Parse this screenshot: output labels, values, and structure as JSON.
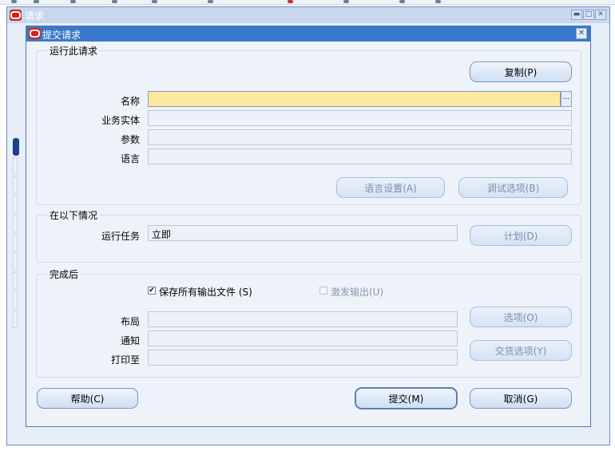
{
  "background_window": {
    "title": "请求"
  },
  "dialog": {
    "title": "提交请求",
    "run_group": {
      "legend": "运行此请求",
      "copy_button": "复制(P)",
      "name_label": "名称",
      "name_value": "",
      "lov_button": "...",
      "ou_label": "业务实体",
      "ou_value": "",
      "params_label": "参数",
      "params_value": "",
      "language_label": "语言",
      "language_value": "",
      "language_settings_button": "语言设置(A)",
      "debug_options_button": "调试选项(B)"
    },
    "when_group": {
      "legend": "在以下情况",
      "run_job_label": "运行任务",
      "run_job_value": "立即",
      "schedule_button": "计划(D)"
    },
    "completion_group": {
      "legend": "完成后",
      "save_output_label": "保存所有输出文件 (S)",
      "save_output_checked": true,
      "burst_output_label": "激发输出(U)",
      "burst_output_checked": false,
      "layout_label": "布局",
      "layout_value": "",
      "notify_label": "通知",
      "notify_value": "",
      "print_to_label": "打印至",
      "print_to_value": "",
      "options_button": "选项(O)",
      "delivery_options_button": "交货选项(Y)"
    },
    "help_button": "帮助(C)",
    "submit_button": "提交(M)",
    "cancel_button": "取消(G)"
  },
  "icons": {
    "app_logo": "oracle-logo-icon",
    "minimize": "minimize-icon",
    "maximize": "maximize-icon",
    "close": "close-icon",
    "checkbox_checked": "checkmark-icon"
  },
  "colors": {
    "dialog_titlebar": "#3a78c8",
    "active_field": "#fde8a1",
    "dialog_background": "#eef3fa"
  }
}
